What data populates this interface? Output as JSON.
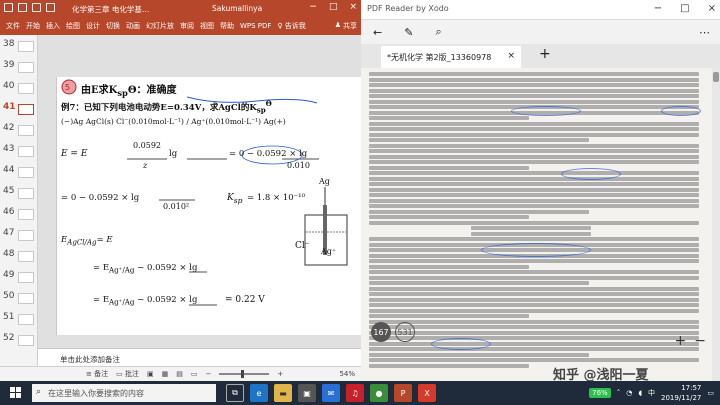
{
  "ppt": {
    "title": "化学第三章 电化学基…",
    "user": "Sakumallinya",
    "tabs": [
      "文件",
      "开始",
      "插入",
      "绘图",
      "设计",
      "切换",
      "动画",
      "幻灯片放",
      "审阅",
      "视图",
      "帮助",
      "WPS PDF"
    ],
    "tell_me": "告诉我",
    "share": "共享",
    "thumb_numbers": [
      "38",
      "39",
      "40",
      "41",
      "42",
      "43",
      "44",
      "45",
      "46",
      "47",
      "48",
      "49",
      "50",
      "51",
      "52"
    ],
    "active_thumb": "41",
    "notes_placeholder": "单击此处添加备注",
    "status": {
      "notes_label": "备注",
      "comments_label": "批注",
      "zoom": "54%"
    }
  },
  "slide": {
    "heading": "由E求K",
    "heading_sub": "sp",
    "heading_rest": "Θ：准确度",
    "example_line": "例7：已知下列电池电动势E=0.34V，求AgCl的K",
    "example_sub": "sp",
    "example_sup": "Θ",
    "cell_line": "(−)Ag  AgCl(s)  Cl⁻(0.010mol·L⁻¹) / Ag⁺(0.010mol·L⁻¹)  Ag(+)",
    "eq1_left": "E = E",
    "eq1_frac_num": "0.0592",
    "eq1_frac_den": "z",
    "eq1_lg": "lg",
    "eq1_mid": "= 0 − 0.0592 × lg",
    "eq1_denval": "0.010",
    "eq2": "= 0 − 0.0592 × lg",
    "eq2_den": "0.010²",
    "ksp_result": "K",
    "ksp_value": "= 1.8 × 10⁻¹⁰",
    "e_agcl": "E",
    "e_agcl_sub": "AgCl/Ag",
    "e_agcl_eq": "= E",
    "line_a": "= E",
    "line_a_sub": "Ag⁺/Ag",
    "line_a_rest": "− 0.0592 × lg",
    "line_b_rest": "− 0.0592 × lg",
    "result": "= 0.22 V",
    "beaker_label": "Ag",
    "cl_label": "Cl⁻",
    "agcl_label": "Ag⁺"
  },
  "pdf": {
    "window_title": "PDF Reader by Xodo",
    "tab_title": "*无机化学 第2版_13360978",
    "page_badge_1": "167",
    "page_badge_2": "531",
    "watermark": "知乎 @浅阳一夏"
  },
  "taskbar": {
    "search_placeholder": "在这里输入你要搜索的内容",
    "battery": "76%",
    "time": "17:57",
    "date": "2019/11/27",
    "ime": "中"
  }
}
